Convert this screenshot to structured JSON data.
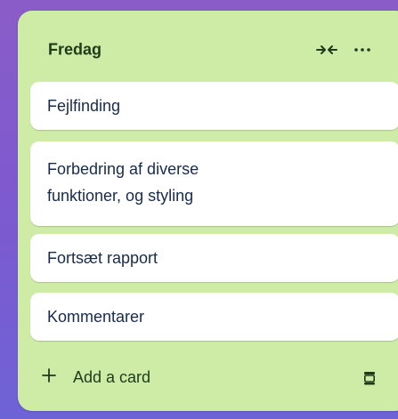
{
  "list": {
    "title": "Fredag",
    "cards": [
      {
        "title": "Fejlfinding"
      },
      {
        "title_line1": "Forbedring af diverse",
        "title_line2": "funktioner, og styling"
      },
      {
        "title": "Fortsæt rapport"
      },
      {
        "title": "Kommentarer"
      }
    ],
    "add_card_label": "Add a card",
    "icons": {
      "collapse": "collapse-arrows-icon",
      "more": "more-horizontal-icon",
      "add": "plus-icon",
      "template": "card-template-icon"
    }
  },
  "colors": {
    "list_background": "#cfeca7",
    "card_background": "#ffffff",
    "text": "#172b4d",
    "header_text": "#1f3b1a"
  }
}
